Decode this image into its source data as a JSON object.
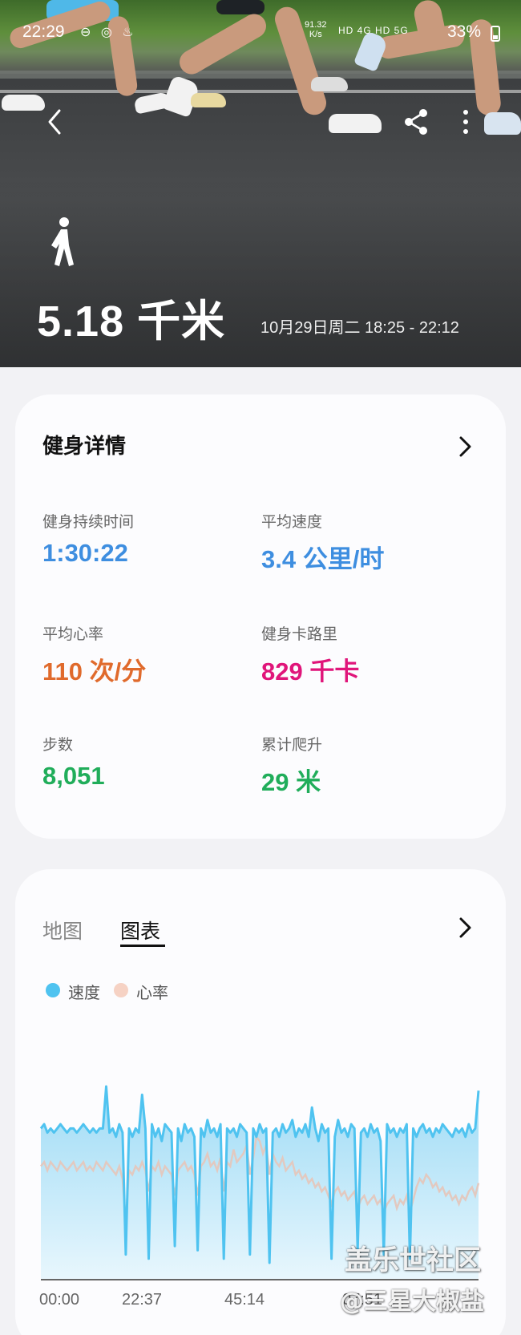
{
  "status_bar": {
    "time": "22:29",
    "net_speed_value": "91.32",
    "net_speed_unit": "K/s",
    "net_labels": "HD 4G HD 5G",
    "battery": "33%"
  },
  "header": {
    "distance": "5.18 千米",
    "session_time": "10月29日周二 18:25 - 22:12"
  },
  "details": {
    "title": "健身详情",
    "metrics": [
      {
        "label": "健身持续时间",
        "value": "1:30:22",
        "color": "#3e8ee0"
      },
      {
        "label": "平均速度",
        "value": "3.4 公里/时",
        "color": "#3e8ee0"
      },
      {
        "label": "平均心率",
        "value": "110 次/分",
        "color": "#e06a2c"
      },
      {
        "label": "健身卡路里",
        "value": "829 千卡",
        "color": "#e0157a"
      },
      {
        "label": "步数",
        "value": "8,051",
        "color": "#20ad5a"
      },
      {
        "label": "累计爬升",
        "value": "29 米",
        "color": "#20ad5a"
      }
    ]
  },
  "chart_card": {
    "tabs": [
      "地图",
      "图表"
    ],
    "active_tab": "图表",
    "legend": [
      {
        "label": "速度",
        "color": "#4fc3f0"
      },
      {
        "label": "心率",
        "color": "#f6d2c4"
      }
    ]
  },
  "chart_data": {
    "type": "line",
    "x_tick_labels": [
      "00:00",
      "22:37",
      "45:14",
      "07:51"
    ],
    "series": [
      {
        "name": "速度",
        "color": "#4fc3f0",
        "values": [
          3.6,
          3.7,
          3.5,
          3.6,
          3.5,
          3.6,
          3.7,
          3.6,
          3.5,
          3.6,
          3.6,
          3.5,
          3.6,
          3.7,
          3.6,
          3.5,
          3.6,
          3.5,
          3.6,
          3.6,
          4.6,
          3.5,
          3.6,
          3.4,
          3.7,
          3.5,
          0.6,
          3.6,
          3.4,
          3.6,
          3.5,
          4.4,
          3.6,
          0.5,
          3.7,
          3.4,
          3.6,
          3.3,
          3.7,
          3.6,
          3.5,
          0.8,
          3.6,
          3.3,
          3.7,
          3.5,
          3.6,
          3.4,
          0.7,
          3.6,
          3.4,
          3.8,
          3.5,
          3.6,
          3.4,
          3.7,
          0.5,
          3.6,
          3.5,
          3.6,
          3.4,
          3.7,
          3.6,
          3.5,
          0.6,
          3.6,
          3.4,
          3.7,
          3.5,
          3.6,
          0.4,
          3.5,
          3.6,
          3.4,
          3.7,
          3.5,
          3.6,
          3.8,
          3.4,
          3.6,
          3.5,
          3.7,
          3.4,
          4.1,
          3.6,
          3.3,
          3.7,
          3.5,
          3.6,
          0.5,
          3.4,
          3.8,
          3.5,
          3.6,
          3.4,
          3.7,
          3.6,
          0.7,
          3.5,
          3.6,
          3.4,
          3.7,
          3.5,
          3.6,
          3.3,
          0.6,
          3.7,
          3.5,
          3.6,
          3.4,
          3.6,
          3.5,
          3.7,
          0.5,
          3.6,
          3.4,
          3.6,
          3.7,
          3.5,
          3.6,
          3.4,
          3.6,
          3.5,
          3.7,
          3.6,
          3.5,
          3.4,
          3.6,
          3.5,
          3.6,
          3.4,
          3.7,
          3.5,
          3.6,
          4.5
        ]
      },
      {
        "name": "心率",
        "color": "#f6d2c4",
        "values": [
          2.7,
          2.8,
          2.6,
          2.8,
          2.7,
          2.6,
          2.8,
          2.7,
          2.6,
          2.7,
          2.8,
          2.6,
          2.7,
          2.8,
          2.6,
          2.7,
          2.6,
          2.8,
          2.7,
          2.6,
          2.8,
          2.7,
          2.6,
          2.5,
          2.7,
          2.4,
          1.4,
          2.6,
          2.5,
          2.7,
          2.6,
          2.8,
          2.6,
          2.1,
          2.7,
          2.6,
          2.8,
          2.5,
          2.7,
          2.6,
          2.5,
          2.0,
          2.6,
          2.7,
          2.8,
          2.6,
          2.7,
          2.5,
          2.0,
          2.7,
          2.8,
          3.0,
          2.7,
          2.8,
          2.6,
          2.9,
          2.1,
          2.8,
          2.7,
          3.1,
          2.8,
          2.9,
          3.0,
          3.2,
          2.5,
          2.9,
          3.4,
          3.3,
          3.0,
          3.2,
          2.5,
          3.0,
          2.8,
          2.7,
          2.9,
          2.6,
          2.7,
          2.8,
          2.5,
          2.6,
          2.4,
          2.5,
          2.3,
          2.4,
          2.2,
          2.3,
          2.1,
          2.2,
          2.0,
          1.8,
          2.1,
          2.2,
          2.0,
          2.1,
          1.9,
          2.0,
          2.1,
          1.7,
          1.9,
          2.0,
          1.8,
          1.9,
          2.0,
          1.8,
          1.9,
          1.6,
          1.8,
          1.9,
          2.0,
          1.7,
          1.9,
          1.8,
          2.0,
          1.6,
          1.9,
          2.2,
          2.4,
          2.3,
          2.5,
          2.4,
          2.2,
          2.3,
          2.1,
          2.2,
          2.0,
          2.1,
          1.9,
          2.0,
          1.8,
          2.0,
          1.9,
          2.1,
          2.2,
          2.0,
          2.3
        ]
      }
    ],
    "y_range": [
      0,
      5
    ]
  },
  "watermark": {
    "line1": "盖乐世社区",
    "line2": "@三星大椒盐"
  }
}
